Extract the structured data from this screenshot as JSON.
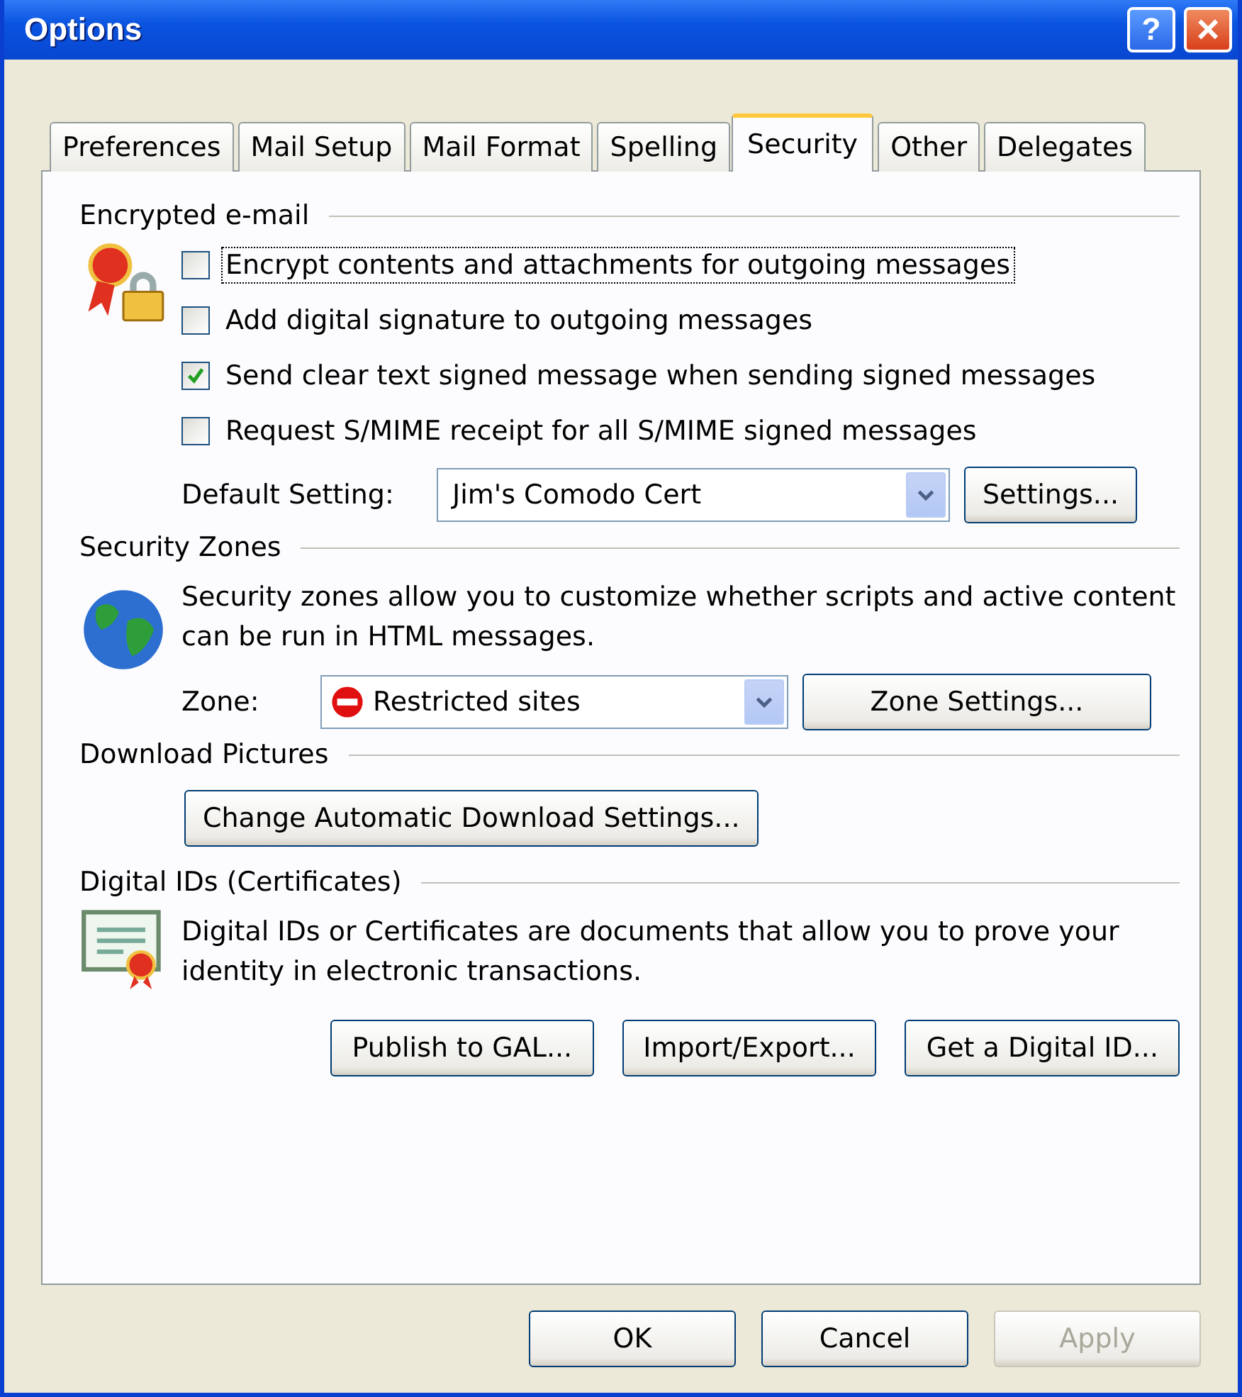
{
  "window": {
    "title": "Options",
    "help": "?",
    "close": "×"
  },
  "tabs": [
    {
      "label": "Preferences",
      "selected": false
    },
    {
      "label": "Mail Setup",
      "selected": false
    },
    {
      "label": "Mail Format",
      "selected": false
    },
    {
      "label": "Spelling",
      "selected": false
    },
    {
      "label": "Security",
      "selected": true
    },
    {
      "label": "Other",
      "selected": false
    },
    {
      "label": "Delegates",
      "selected": false
    }
  ],
  "encrypted": {
    "heading": "Encrypted e-mail",
    "options": [
      {
        "label": "Encrypt contents and attachments for outgoing messages",
        "checked": false,
        "focused": true
      },
      {
        "label": "Add digital signature to outgoing messages",
        "checked": false,
        "focused": false
      },
      {
        "label": "Send clear text signed message when sending signed messages",
        "checked": true,
        "focused": false
      },
      {
        "label": "Request S/MIME receipt for all S/MIME signed messages",
        "checked": false,
        "focused": false
      }
    ],
    "default_label": "Default Setting:",
    "default_value": "Jim's Comodo Cert",
    "settings_button": "Settings..."
  },
  "zones": {
    "heading": "Security Zones",
    "description": "Security zones allow you to customize whether scripts and active content can be run in HTML messages.",
    "zone_label": "Zone:",
    "zone_value": "Restricted sites",
    "zone_button": "Zone Settings..."
  },
  "pictures": {
    "heading": "Download Pictures",
    "button": "Change Automatic Download Settings..."
  },
  "ids": {
    "heading": "Digital IDs (Certificates)",
    "description": "Digital IDs or Certificates are documents that allow you to prove your identity in electronic transactions.",
    "buttons": [
      "Publish to GAL...",
      "Import/Export...",
      "Get a Digital ID..."
    ]
  },
  "footer": [
    {
      "label": "OK",
      "disabled": false
    },
    {
      "label": "Cancel",
      "disabled": false
    },
    {
      "label": "Apply",
      "disabled": true
    }
  ]
}
